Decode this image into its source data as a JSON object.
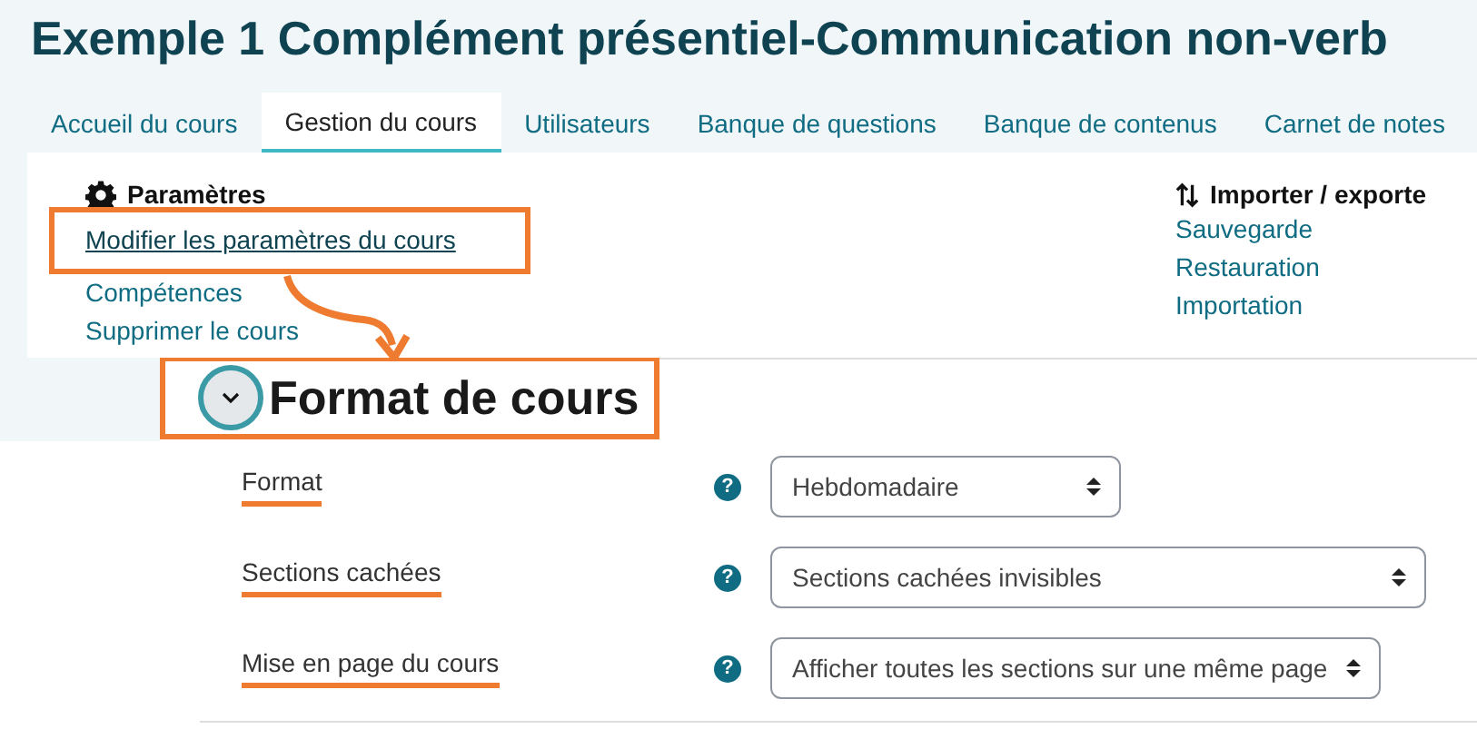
{
  "page_title": "Exemple 1 Complément présentiel-Communication non-verb",
  "tabs": [
    {
      "label": "Accueil du cours",
      "selected": false
    },
    {
      "label": "Gestion du cours",
      "selected": true
    },
    {
      "label": "Utilisateurs",
      "selected": false
    },
    {
      "label": "Banque de questions",
      "selected": false
    },
    {
      "label": "Banque de contenus",
      "selected": false
    },
    {
      "label": "Carnet de notes",
      "selected": false
    }
  ],
  "settings": {
    "heading": "Paramètres",
    "links": [
      {
        "label": "Modifier les paramètres du cours",
        "highlighted": true
      },
      {
        "label": "Compétences",
        "highlighted": false
      },
      {
        "label": "Supprimer le cours",
        "highlighted": false
      }
    ]
  },
  "import_export": {
    "heading": "Importer / exporte",
    "links": [
      {
        "label": "Sauvegarde"
      },
      {
        "label": "Restauration"
      },
      {
        "label": "Importation"
      }
    ]
  },
  "section": {
    "heading": "Format de cours",
    "expanded": true,
    "highlighted": true,
    "fields": [
      {
        "label": "Format",
        "help": "?",
        "value": "Hebdomadaire"
      },
      {
        "label": "Sections cachées",
        "help": "?",
        "value": "Sections cachées invisibles"
      },
      {
        "label": "Mise en page du cours",
        "help": "?",
        "value": "Afficher toutes les sections sur une même page"
      }
    ]
  }
}
